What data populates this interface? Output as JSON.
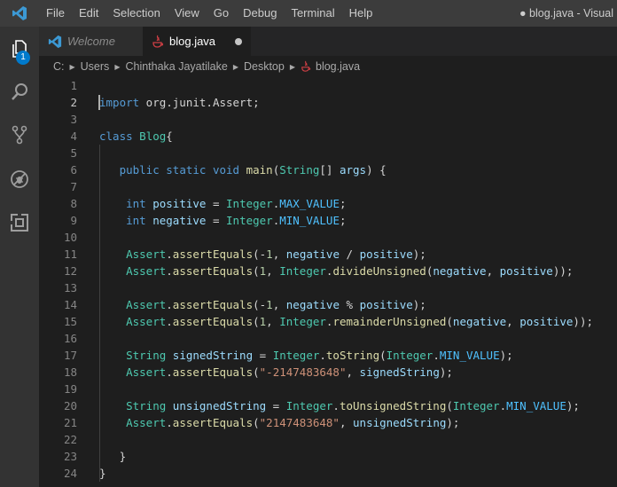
{
  "menu": {
    "items": [
      "File",
      "Edit",
      "Selection",
      "View",
      "Go",
      "Debug",
      "Terminal",
      "Help"
    ]
  },
  "window_title": "● blog.java - Visual",
  "activity_bar": {
    "explorer_badge": "1",
    "icons": [
      "files-icon",
      "search-icon",
      "source-control-icon",
      "debug-icon",
      "extensions-icon"
    ]
  },
  "tabs": [
    {
      "label": "Welcome",
      "active": false
    },
    {
      "label": "blog.java",
      "active": true,
      "dirty": true
    }
  ],
  "breadcrumb": [
    "C:",
    "Users",
    "Chinthaka Jayatilake",
    "Desktop",
    "blog.java"
  ],
  "colors": {
    "keyword": "#569cd6",
    "type": "#4ec9b0",
    "function": "#dcdcaa",
    "variable": "#9cdcfe",
    "constant": "#4fc1ff",
    "number": "#b5cea8",
    "string": "#ce9178",
    "accent": "#007acc"
  },
  "editor": {
    "active_line": 2,
    "lines": [
      {
        "n": "1",
        "tokens": []
      },
      {
        "n": "2",
        "tokens": [
          [
            "k",
            "import"
          ],
          [
            "p",
            " org.junit.Assert;"
          ]
        ]
      },
      {
        "n": "3",
        "tokens": []
      },
      {
        "n": "4",
        "tokens": [
          [
            "k",
            "class"
          ],
          [
            "p",
            " "
          ],
          [
            "t",
            "Blog"
          ],
          [
            "p",
            "{"
          ]
        ]
      },
      {
        "n": "5",
        "tokens": []
      },
      {
        "n": "6",
        "tokens": [
          [
            "p",
            "   "
          ],
          [
            "k",
            "public"
          ],
          [
            "p",
            " "
          ],
          [
            "k",
            "static"
          ],
          [
            "p",
            " "
          ],
          [
            "k",
            "void"
          ],
          [
            "p",
            " "
          ],
          [
            "f",
            "main"
          ],
          [
            "p",
            "("
          ],
          [
            "t",
            "String"
          ],
          [
            "p",
            "[] "
          ],
          [
            "v",
            "args"
          ],
          [
            "p",
            ") {"
          ]
        ]
      },
      {
        "n": "7",
        "tokens": []
      },
      {
        "n": "8",
        "tokens": [
          [
            "p",
            "    "
          ],
          [
            "k",
            "int"
          ],
          [
            "p",
            " "
          ],
          [
            "v",
            "positive"
          ],
          [
            "p",
            " = "
          ],
          [
            "t",
            "Integer"
          ],
          [
            "p",
            "."
          ],
          [
            "c",
            "MAX_VALUE"
          ],
          [
            "p",
            ";"
          ]
        ]
      },
      {
        "n": "9",
        "tokens": [
          [
            "p",
            "    "
          ],
          [
            "k",
            "int"
          ],
          [
            "p",
            " "
          ],
          [
            "v",
            "negative"
          ],
          [
            "p",
            " = "
          ],
          [
            "t",
            "Integer"
          ],
          [
            "p",
            "."
          ],
          [
            "c",
            "MIN_VALUE"
          ],
          [
            "p",
            ";"
          ]
        ]
      },
      {
        "n": "10",
        "tokens": []
      },
      {
        "n": "11",
        "tokens": [
          [
            "p",
            "    "
          ],
          [
            "t",
            "Assert"
          ],
          [
            "p",
            "."
          ],
          [
            "f",
            "assertEquals"
          ],
          [
            "p",
            "(-"
          ],
          [
            "n",
            "1"
          ],
          [
            "p",
            ", "
          ],
          [
            "v",
            "negative"
          ],
          [
            "p",
            " / "
          ],
          [
            "v",
            "positive"
          ],
          [
            "p",
            ");"
          ]
        ]
      },
      {
        "n": "12",
        "tokens": [
          [
            "p",
            "    "
          ],
          [
            "t",
            "Assert"
          ],
          [
            "p",
            "."
          ],
          [
            "f",
            "assertEquals"
          ],
          [
            "p",
            "("
          ],
          [
            "n",
            "1"
          ],
          [
            "p",
            ", "
          ],
          [
            "t",
            "Integer"
          ],
          [
            "p",
            "."
          ],
          [
            "f",
            "divideUnsigned"
          ],
          [
            "p",
            "("
          ],
          [
            "v",
            "negative"
          ],
          [
            "p",
            ", "
          ],
          [
            "v",
            "positive"
          ],
          [
            "p",
            "));"
          ]
        ]
      },
      {
        "n": "13",
        "tokens": []
      },
      {
        "n": "14",
        "tokens": [
          [
            "p",
            "    "
          ],
          [
            "t",
            "Assert"
          ],
          [
            "p",
            "."
          ],
          [
            "f",
            "assertEquals"
          ],
          [
            "p",
            "(-"
          ],
          [
            "n",
            "1"
          ],
          [
            "p",
            ", "
          ],
          [
            "v",
            "negative"
          ],
          [
            "p",
            " % "
          ],
          [
            "v",
            "positive"
          ],
          [
            "p",
            ");"
          ]
        ]
      },
      {
        "n": "15",
        "tokens": [
          [
            "p",
            "    "
          ],
          [
            "t",
            "Assert"
          ],
          [
            "p",
            "."
          ],
          [
            "f",
            "assertEquals"
          ],
          [
            "p",
            "("
          ],
          [
            "n",
            "1"
          ],
          [
            "p",
            ", "
          ],
          [
            "t",
            "Integer"
          ],
          [
            "p",
            "."
          ],
          [
            "f",
            "remainderUnsigned"
          ],
          [
            "p",
            "("
          ],
          [
            "v",
            "negative"
          ],
          [
            "p",
            ", "
          ],
          [
            "v",
            "positive"
          ],
          [
            "p",
            "));"
          ]
        ]
      },
      {
        "n": "16",
        "tokens": []
      },
      {
        "n": "17",
        "tokens": [
          [
            "p",
            "    "
          ],
          [
            "t",
            "String"
          ],
          [
            "p",
            " "
          ],
          [
            "v",
            "signedString"
          ],
          [
            "p",
            " = "
          ],
          [
            "t",
            "Integer"
          ],
          [
            "p",
            "."
          ],
          [
            "f",
            "toString"
          ],
          [
            "p",
            "("
          ],
          [
            "t",
            "Integer"
          ],
          [
            "p",
            "."
          ],
          [
            "c",
            "MIN_VALUE"
          ],
          [
            "p",
            ");"
          ]
        ]
      },
      {
        "n": "18",
        "tokens": [
          [
            "p",
            "    "
          ],
          [
            "t",
            "Assert"
          ],
          [
            "p",
            "."
          ],
          [
            "f",
            "assertEquals"
          ],
          [
            "p",
            "("
          ],
          [
            "s",
            "\"-2147483648\""
          ],
          [
            "p",
            ", "
          ],
          [
            "v",
            "signedString"
          ],
          [
            "p",
            ");"
          ]
        ]
      },
      {
        "n": "19",
        "tokens": []
      },
      {
        "n": "20",
        "tokens": [
          [
            "p",
            "    "
          ],
          [
            "t",
            "String"
          ],
          [
            "p",
            " "
          ],
          [
            "v",
            "unsignedString"
          ],
          [
            "p",
            " = "
          ],
          [
            "t",
            "Integer"
          ],
          [
            "p",
            "."
          ],
          [
            "f",
            "toUnsignedString"
          ],
          [
            "p",
            "("
          ],
          [
            "t",
            "Integer"
          ],
          [
            "p",
            "."
          ],
          [
            "c",
            "MIN_VALUE"
          ],
          [
            "p",
            ");"
          ]
        ]
      },
      {
        "n": "21",
        "tokens": [
          [
            "p",
            "    "
          ],
          [
            "t",
            "Assert"
          ],
          [
            "p",
            "."
          ],
          [
            "f",
            "assertEquals"
          ],
          [
            "p",
            "("
          ],
          [
            "s",
            "\"2147483648\""
          ],
          [
            "p",
            ", "
          ],
          [
            "v",
            "unsignedString"
          ],
          [
            "p",
            ");"
          ]
        ]
      },
      {
        "n": "22",
        "tokens": []
      },
      {
        "n": "23",
        "tokens": [
          [
            "p",
            "   }"
          ]
        ]
      },
      {
        "n": "24",
        "tokens": [
          [
            "p",
            "}"
          ]
        ]
      }
    ]
  }
}
